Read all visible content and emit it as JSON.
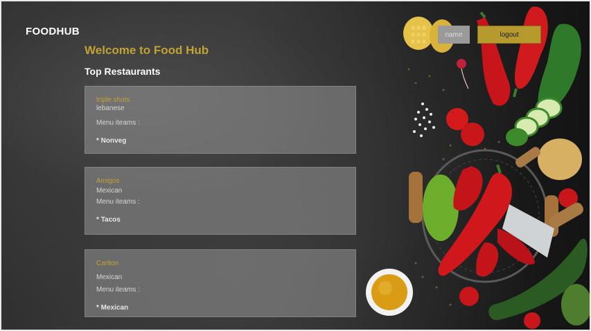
{
  "header": {
    "brand": "FOODHUB",
    "name_button": "name",
    "logout_button": "logout"
  },
  "main": {
    "welcome": "Welcome to Food Hub",
    "section_title": "Top Restaurants",
    "menu_label": "Menu iteams :",
    "restaurants": [
      {
        "name": "triple shots",
        "cuisine": "lebanese",
        "menu_item": "* Nonveg"
      },
      {
        "name": "Amigos",
        "cuisine": "Mexican",
        "menu_item": "* Tacos"
      },
      {
        "name": "Carlton",
        "cuisine": "Mexican",
        "menu_item": "* Mexican"
      }
    ]
  },
  "colors": {
    "accent": "#c2a233",
    "logout_bg": "#b59a2d",
    "background": "#2a2a2a"
  }
}
